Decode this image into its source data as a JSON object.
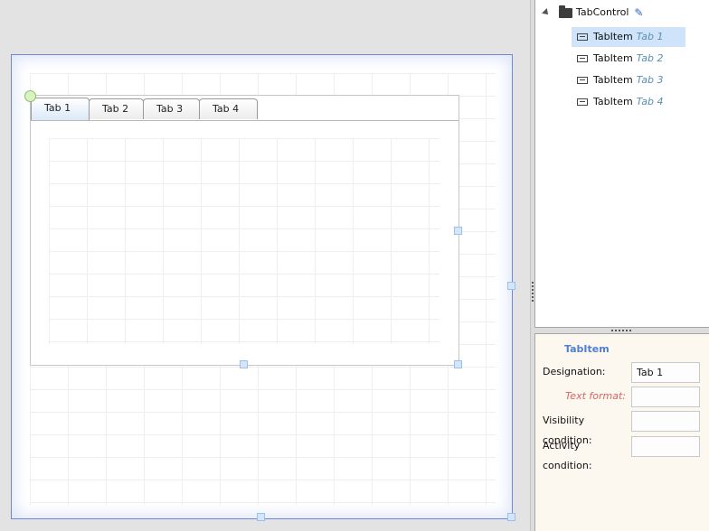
{
  "canvas": {
    "tabs": [
      {
        "label": "Tab 1",
        "active": true
      },
      {
        "label": "Tab 2",
        "active": false
      },
      {
        "label": "Tab 3",
        "active": false
      },
      {
        "label": "Tab 4",
        "active": false
      }
    ]
  },
  "tree": {
    "root": {
      "label": "TabControl",
      "icon": "folder-icon",
      "edit_icon": "pencil-icon"
    },
    "items": [
      {
        "type": "TabItem",
        "name": "Tab 1",
        "selected": true
      },
      {
        "type": "TabItem",
        "name": "Tab 2",
        "selected": false
      },
      {
        "type": "TabItem",
        "name": "Tab 3",
        "selected": false
      },
      {
        "type": "TabItem",
        "name": "Tab 4",
        "selected": false
      }
    ]
  },
  "properties": {
    "title": "TabItem",
    "designation_label": "Designation:",
    "designation_value": "Tab 1",
    "text_format_label": "Text format:",
    "text_format_value": "",
    "visibility_label": "Visibility condition:",
    "visibility_value": "",
    "activity_label": "Activity condition:",
    "activity_value": ""
  },
  "colors": {
    "selection_border": "#6f88d8",
    "tree_selection": "#cfe4fa",
    "props_background": "#fcf8ef",
    "title_accent": "#4f7fd4",
    "muted_label": "#d76565"
  }
}
